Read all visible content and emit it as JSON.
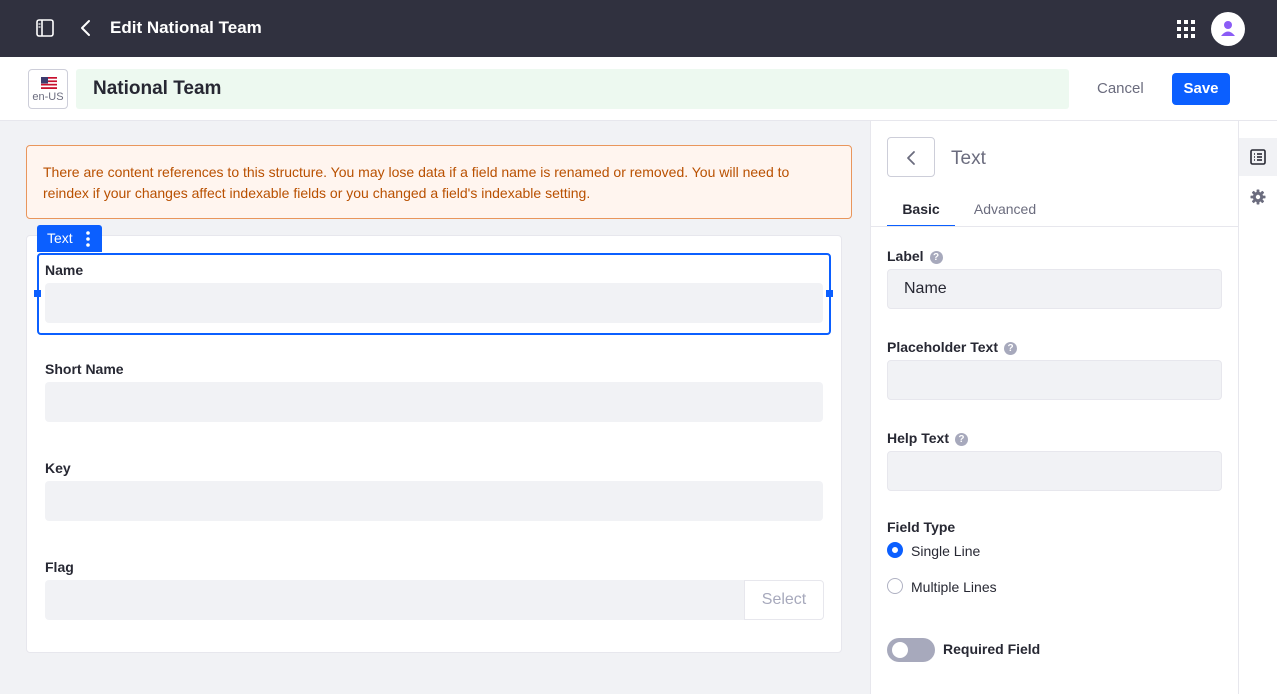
{
  "topbar": {
    "title": "Edit National Team"
  },
  "header": {
    "locale": "en-US",
    "name_value": "National Team",
    "cancel_label": "Cancel",
    "save_label": "Save"
  },
  "alert": {
    "message": "There are content references to this structure. You may lose data if a field name is renamed or removed. You will need to reindex if your changes affect indexable fields or you changed a field's indexable setting."
  },
  "form": {
    "selected_field_tag": "Text",
    "fields": [
      {
        "label": "Name"
      },
      {
        "label": "Short Name"
      },
      {
        "label": "Key"
      },
      {
        "label": "Flag",
        "button_label": "Select"
      }
    ]
  },
  "panel": {
    "title": "Text",
    "tabs": [
      "Basic",
      "Advanced"
    ],
    "active_tab": "Basic",
    "label_field": {
      "label": "Label",
      "value": "Name"
    },
    "placeholder_field": {
      "label": "Placeholder Text",
      "value": ""
    },
    "help_field": {
      "label": "Help Text",
      "value": ""
    },
    "field_type": {
      "label": "Field Type",
      "options": [
        "Single Line",
        "Multiple Lines"
      ],
      "selected": "Single Line"
    },
    "required_field": {
      "label": "Required Field",
      "on": false
    }
  },
  "colors": {
    "topbar_bg": "#30313f",
    "primary": "#0b5fff",
    "alert_bg": "#fff5ef",
    "alert_text": "#b95000"
  }
}
